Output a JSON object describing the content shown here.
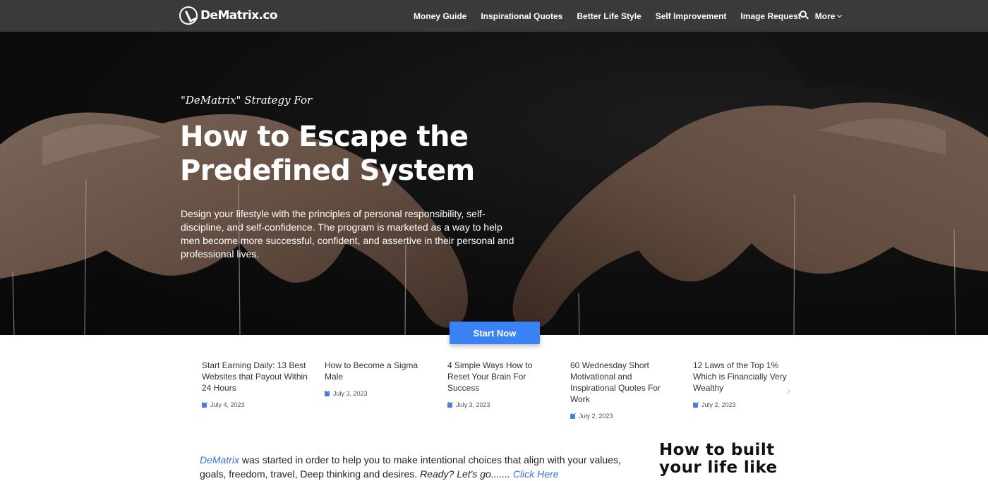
{
  "header": {
    "logo_text": "DeMatrix.co",
    "nav": [
      "Money Guide",
      "Inspirational Quotes",
      "Better Life Style",
      "Self Improvement",
      "Image Request"
    ],
    "more_label": "More",
    "search_icon": "search-icon"
  },
  "hero": {
    "eyebrow": "\"DeMatrix\" Strategy For",
    "title": "How to Escape the Predefined System",
    "description": "Design your lifestyle with the principles of personal responsibility, self-discipline, and self-confidence. The program is marketed as a way to help men become more successful, confident, and assertive in their personal and professional lives.",
    "cta": "Start Now"
  },
  "posts": [
    {
      "title": "Start Earning Daily: 13 Best Websites that Payout Within 24 Hours",
      "date": "July 4, 2023"
    },
    {
      "title": "How to Become a Sigma Male",
      "date": "July 3, 2023"
    },
    {
      "title": "4 Simple Ways How to Reset Your Brain For Success",
      "date": "July 3, 2023"
    },
    {
      "title": "60 Wednesday Short Motivational and Inspirational Quotes For Work",
      "date": "July 2, 2023"
    },
    {
      "title": "12 Laws of the Top 1% Which is Financially Very Wealthy",
      "date": "July 2, 2023"
    }
  ],
  "intro": {
    "link": "DeMatrix",
    "text": " was started in order to help you to make intentional choices that align with your values, goals, freedom, travel, Deep thinking and desires. ",
    "ready": "Ready? Let's go....... ",
    "click": "Click Here"
  },
  "sidebar": {
    "heading": "How to built your life like"
  },
  "colors": {
    "nav_bg": "#3a3a3a",
    "accent": "#3b82f6",
    "link": "#3b6fd8"
  }
}
